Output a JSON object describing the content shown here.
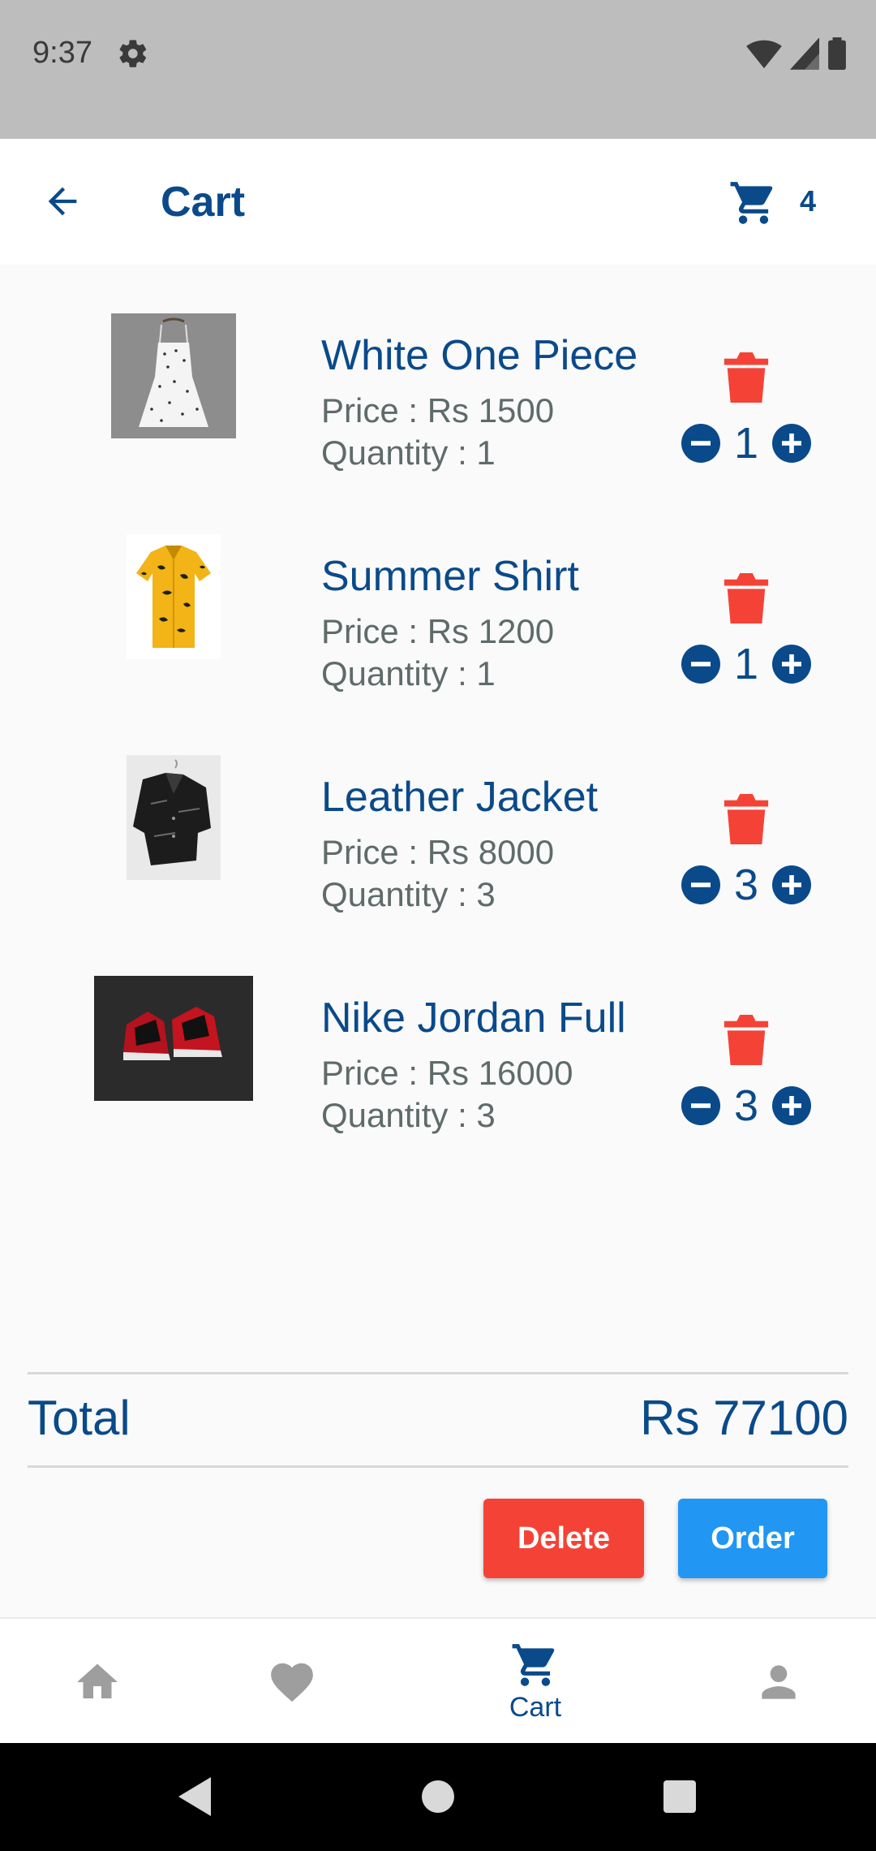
{
  "status_bar": {
    "time": "9:37"
  },
  "app_bar": {
    "title": "Cart",
    "cart_count": "4"
  },
  "items": [
    {
      "name": "White One Piece",
      "price": "Price : Rs 1500",
      "quantity_label": "Quantity : 1",
      "quantity": "1",
      "image": "white-dress-image"
    },
    {
      "name": "Summer Shirt",
      "price": "Price : Rs 1200",
      "quantity_label": "Quantity : 1",
      "quantity": "1",
      "image": "yellow-shirt-image"
    },
    {
      "name": "Leather Jacket",
      "price": "Price : Rs 8000",
      "quantity_label": "Quantity : 3",
      "quantity": "3",
      "image": "leather-jacket-image"
    },
    {
      "name": "Nike Jordan Full",
      "price": "Price : Rs 16000",
      "quantity_label": "Quantity : 3",
      "quantity": "3",
      "image": "sneakers-image"
    }
  ],
  "summary": {
    "total_label": "Total",
    "total_value": "Rs 77100"
  },
  "actions": {
    "delete_label": "Delete",
    "order_label": "Order"
  },
  "bottom_nav": {
    "items": [
      {
        "icon": "home-icon",
        "label": ""
      },
      {
        "icon": "heart-icon",
        "label": ""
      },
      {
        "icon": "cart-icon",
        "label": "Cart",
        "active": true
      },
      {
        "icon": "person-icon",
        "label": ""
      }
    ]
  },
  "colors": {
    "primary": "#0a4a8a",
    "danger": "#f44336",
    "accent": "#2196f3",
    "muted_text": "#5f6b6a"
  }
}
